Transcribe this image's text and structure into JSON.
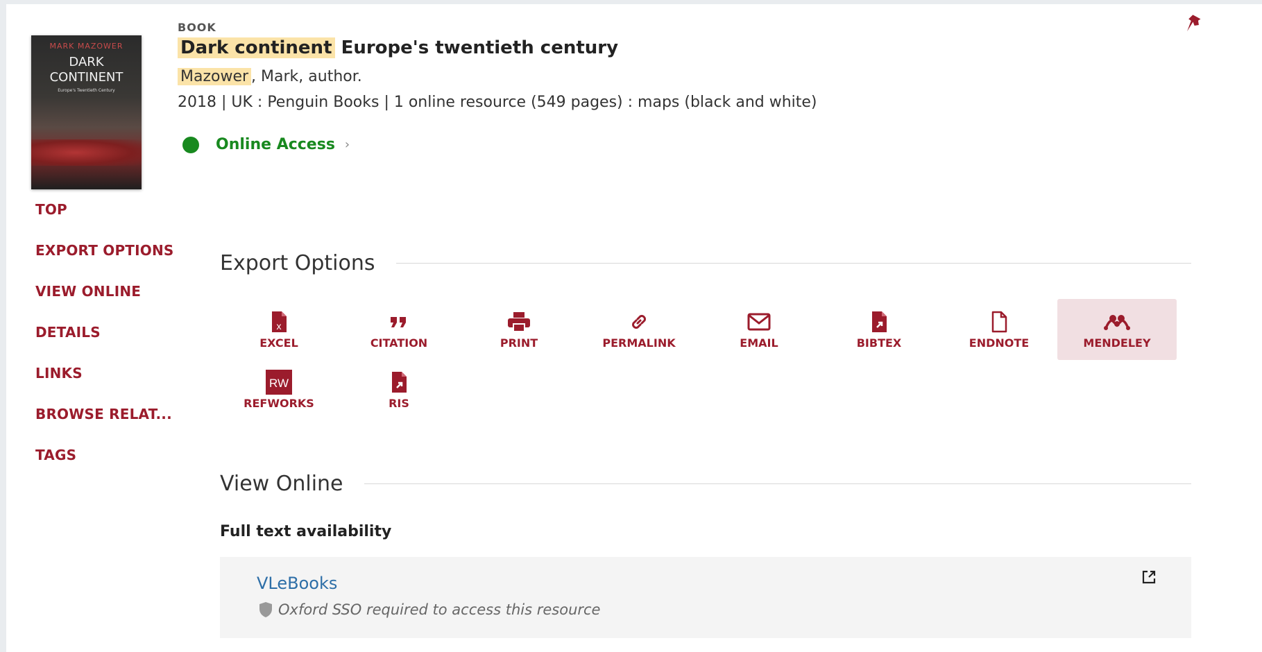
{
  "record": {
    "type": "BOOK",
    "title_highlight": "Dark continent",
    "title_rest": "Europe's twentieth century",
    "author_highlight": "Mazower",
    "author_rest": ", Mark, author.",
    "publication": "2018 | UK : Penguin Books | 1 online resource (549 pages) : maps (black and white)",
    "access_label": "Online Access",
    "access_chevron": "›"
  },
  "cover": {
    "author": "MARK MAZOWER",
    "title_line1": "DARK",
    "title_line2": "CONTINENT",
    "subtitle": "Europe's Twentieth Century"
  },
  "nav": {
    "items": [
      "TOP",
      "EXPORT OPTIONS",
      "VIEW ONLINE",
      "DETAILS",
      "LINKS",
      "BROWSE RELAT...",
      "TAGS"
    ]
  },
  "export": {
    "heading": "Export Options",
    "buttons": [
      {
        "label": "EXCEL",
        "icon": "excel-icon"
      },
      {
        "label": "CITATION",
        "icon": "quote-icon"
      },
      {
        "label": "PRINT",
        "icon": "printer-icon"
      },
      {
        "label": "PERMALINK",
        "icon": "link-icon"
      },
      {
        "label": "EMAIL",
        "icon": "envelope-icon"
      },
      {
        "label": "BIBTEX",
        "icon": "bibtex-file-icon"
      },
      {
        "label": "ENDNOTE",
        "icon": "file-icon"
      },
      {
        "label": "MENDELEY",
        "icon": "mendeley-icon"
      },
      {
        "label": "REFWORKS",
        "icon": "refworks-icon",
        "icon_text": "RW"
      },
      {
        "label": "RIS",
        "icon": "ris-file-icon"
      }
    ]
  },
  "view_online": {
    "heading": "View Online",
    "full_text_label": "Full text availability",
    "resource_name": "VLeBooks",
    "resource_note": "Oxford SSO required to access this resource"
  },
  "colors": {
    "accent": "#9b1c2c",
    "online_green": "#18891f",
    "highlight": "#fbe3a8",
    "link_blue": "#2d6ea7",
    "active_bg": "#f1dfe2"
  }
}
